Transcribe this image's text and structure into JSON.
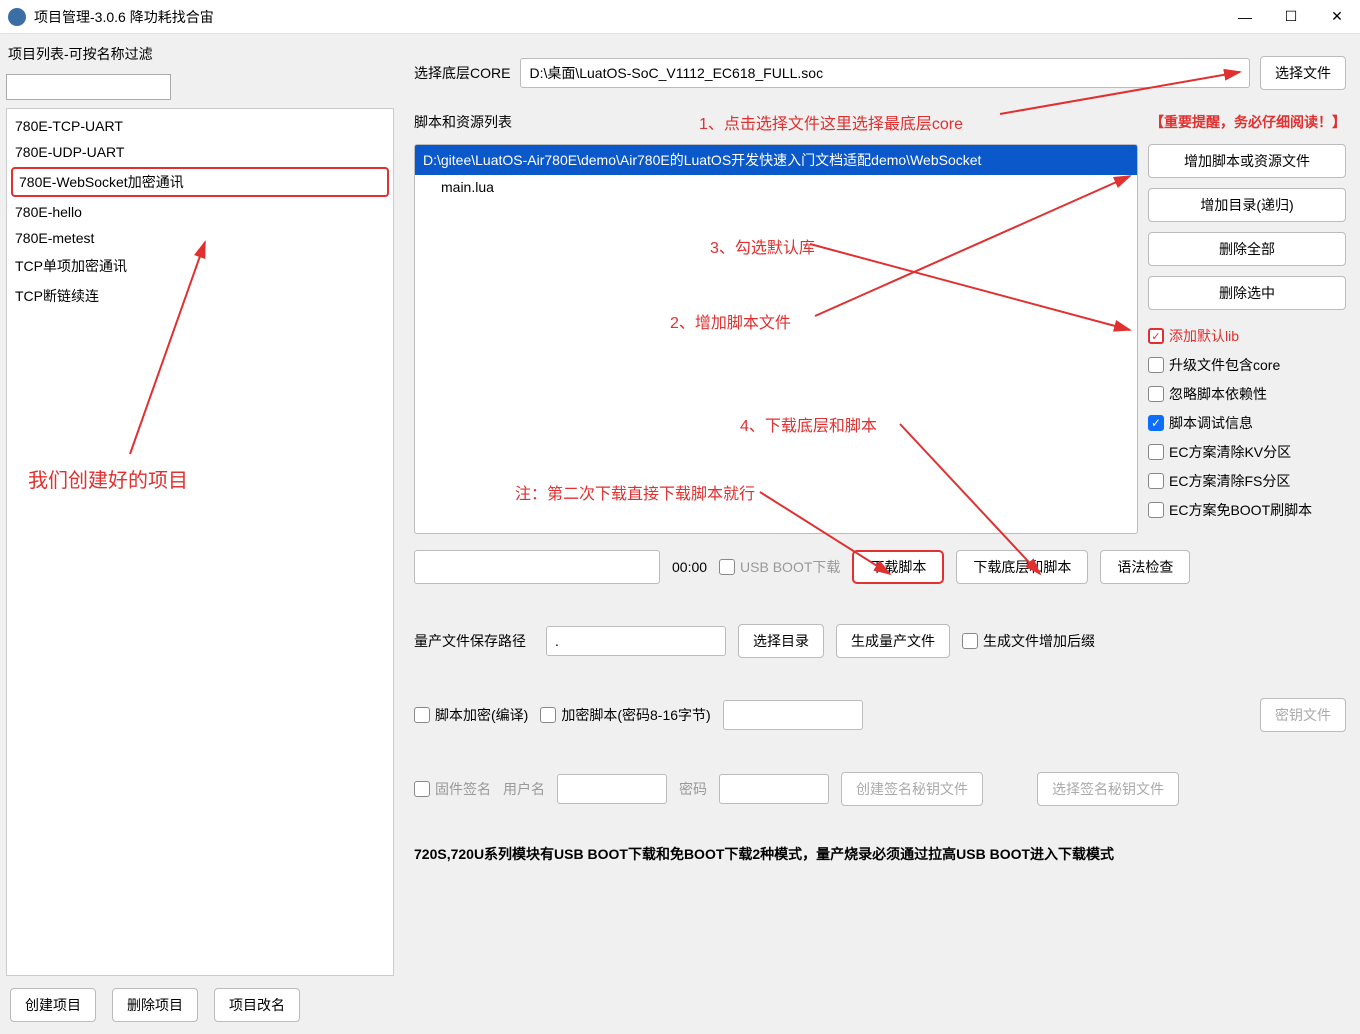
{
  "titlebar": {
    "title": "项目管理-3.0.6 降功耗找合宙"
  },
  "sidebar": {
    "header": "项目列表-可按名称过滤",
    "filter_value": "",
    "items": [
      {
        "label": "780E-TCP-UART"
      },
      {
        "label": "780E-UDP-UART"
      },
      {
        "label": "780E-WebSocket加密通讯",
        "selected": true
      },
      {
        "label": "780E-hello"
      },
      {
        "label": "780E-metest"
      },
      {
        "label": "TCP单项加密通讯"
      },
      {
        "label": "TCP断链续连"
      }
    ],
    "bottom_buttons": {
      "create": "创建项目",
      "delete": "删除项目",
      "rename": "项目改名"
    }
  },
  "content": {
    "core_label": "选择底层CORE",
    "core_path": "D:\\桌面\\LuatOS-SoC_V1112_EC618_FULL.soc",
    "choose_file_btn": "选择文件",
    "script_list_label": "脚本和资源列表",
    "tree_root": "D:\\gitee\\LuatOS-Air780E\\demo\\Air780E的LuatOS开发快速入门文档适配demo\\WebSocket",
    "tree_child": "main.lua",
    "side_buttons": {
      "add_script": "增加脚本或资源文件",
      "add_dir": "增加目录(递归)",
      "del_all": "删除全部",
      "del_sel": "删除选中"
    },
    "checks": {
      "add_lib": "添加默认lib",
      "upgrade_core": "升级文件包含core",
      "ignore_dep": "忽略脚本依赖性",
      "debug_info": "脚本调试信息",
      "ec_kv": "EC方案清除KV分区",
      "ec_fs": "EC方案清除FS分区",
      "ec_boot": "EC方案免BOOT刷脚本"
    },
    "timer": "00:00",
    "usb_boot_label": "USB BOOT下载",
    "dl_script_btn": "下载脚本",
    "dl_core_btn": "下载底层和脚本",
    "syntax_btn": "语法检查",
    "mass_label": "量产文件保存路径",
    "mass_path": ".",
    "choose_dir_btn": "选择目录",
    "gen_mass_btn": "生成量产文件",
    "gen_suffix_label": "生成文件增加后缀",
    "encrypt_compile": "脚本加密(编译)",
    "encrypt_pwd_label": "加密脚本(密码8-16字节)",
    "key_file_btn": "密钥文件",
    "fw_sign": "固件签名",
    "user_label": "用户名",
    "pwd_label": "密码",
    "create_sign_btn": "创建签名秘钥文件",
    "choose_sign_btn": "选择签名秘钥文件",
    "footer_note": "720S,720U系列模块有USB BOOT下载和免BOOT下载2种模式，量产烧录必须通过拉高USB BOOT进入下载模式"
  },
  "annotations": {
    "a1": "1、点击选择文件这里选择最底层core",
    "a2": "2、增加脚本文件",
    "a3": "3、勾选默认库",
    "a4": "4、下载底层和脚本",
    "note2": "注：第二次下载直接下载脚本就行",
    "important": "【重要提醒，务必仔细阅读！】",
    "created_proj": "我们创建好的项目"
  }
}
